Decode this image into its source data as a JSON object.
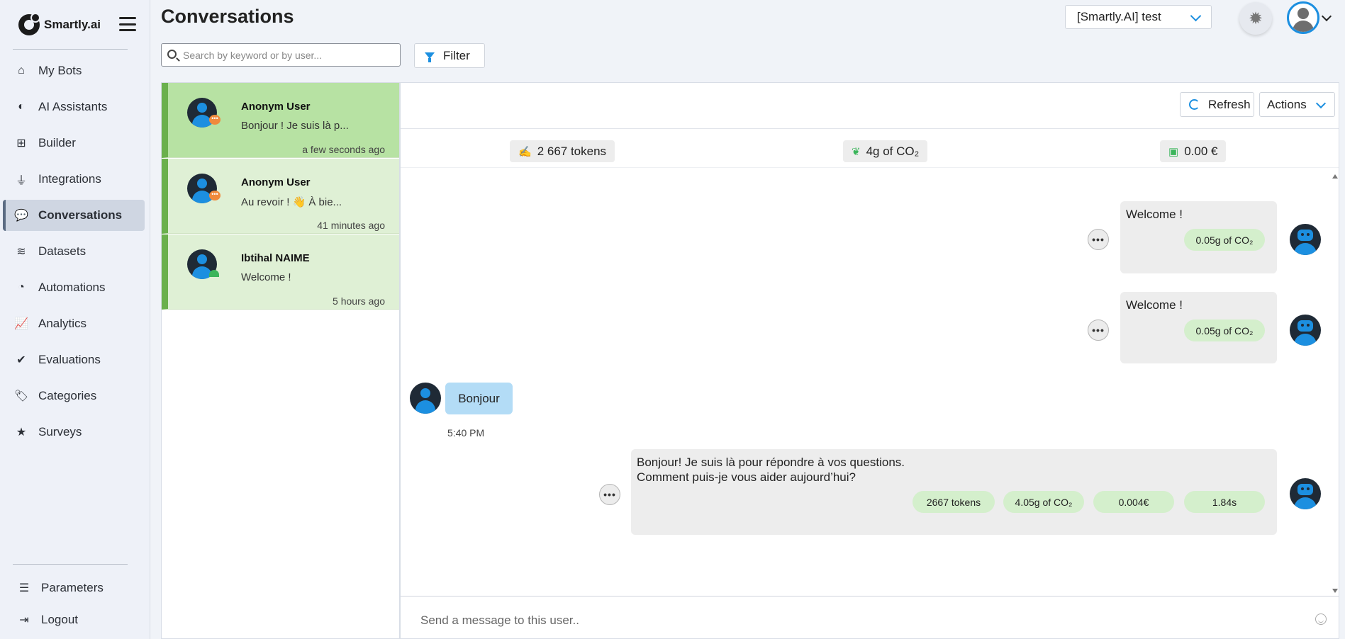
{
  "app": {
    "brand": "Smartly.ai",
    "page_title": "Conversations"
  },
  "sidebar": {
    "items": [
      {
        "label": "My Bots",
        "icon": "home-icon"
      },
      {
        "label": "AI Assistants",
        "icon": "brain-icon"
      },
      {
        "label": "Builder",
        "icon": "sitemap-icon"
      },
      {
        "label": "Integrations",
        "icon": "plug-icon"
      },
      {
        "label": "Conversations",
        "icon": "comments-icon",
        "active": true
      },
      {
        "label": "Datasets",
        "icon": "database-icon"
      },
      {
        "label": "Automations",
        "icon": "clock-icon"
      },
      {
        "label": "Analytics",
        "icon": "chart-line-icon"
      },
      {
        "label": "Evaluations",
        "icon": "check-circle-icon"
      },
      {
        "label": "Categories",
        "icon": "tag-icon"
      },
      {
        "label": "Surveys",
        "icon": "star-icon"
      }
    ],
    "bottom": [
      {
        "label": "Parameters",
        "icon": "sliders-icon"
      },
      {
        "label": "Logout",
        "icon": "logout-icon"
      }
    ]
  },
  "header": {
    "bot_selector": "[Smartly.AI] test"
  },
  "toolbar": {
    "search_placeholder": "Search by keyword or by user...",
    "filter_label": "Filter"
  },
  "conversations": [
    {
      "name": "Anonym User",
      "preview": "Bonjour ! Je suis là p...",
      "time": "a few seconds ago",
      "selected": true
    },
    {
      "name": "Anonym User",
      "preview": "Au revoir ! 👋 À bie...",
      "time": "41 minutes ago"
    },
    {
      "name": "Ibtihal NAIME",
      "preview": "Welcome !",
      "time": "5 hours ago"
    }
  ],
  "chat": {
    "refresh_label": "Refresh",
    "actions_label": "Actions",
    "stats": {
      "tokens": "2 667 tokens",
      "co2": "4g of CO₂",
      "cost": "0.00 €"
    },
    "messages": [
      {
        "role": "bot",
        "text": "Welcome !",
        "chips": [
          "0.05g of CO₂"
        ]
      },
      {
        "role": "bot",
        "text": "Welcome !",
        "chips": [
          "0.05g of CO₂"
        ]
      },
      {
        "role": "user",
        "text": "Bonjour",
        "time": "5:40 PM"
      },
      {
        "role": "bot",
        "line1": "Bonjour! Je suis là pour répondre à vos questions.",
        "line2": "Comment puis-je vous aider aujourd’hui?",
        "chips": [
          "2667 tokens",
          "4.05g of CO₂",
          "0.004€",
          "1.84s"
        ]
      }
    ],
    "composer_placeholder": "Send a message to this user.."
  },
  "colors": {
    "accent": "#1c8fe0",
    "conv_green": "#6ab04c",
    "conv_selected": "#b7e2a3",
    "chip_green": "#d4efcc",
    "user_bubble": "#b3dcf6"
  }
}
